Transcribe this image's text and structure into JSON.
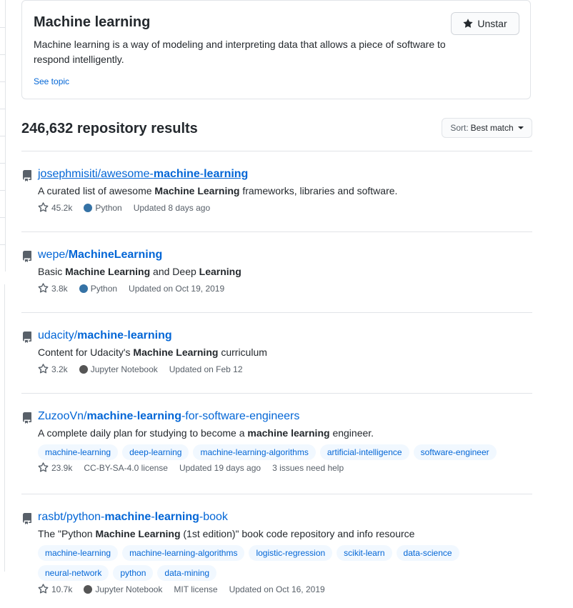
{
  "topic": {
    "title": "Machine learning",
    "description": "Machine learning is a way of modeling and interpreting data that allows a piece of software to respond intelligently.",
    "see_topic": "See topic",
    "unstar_label": "Unstar"
  },
  "results": {
    "count_label": "246,632 repository results",
    "sort_prefix": "Sort:",
    "sort_value": "Best match"
  },
  "colors": {
    "link": "#0366d6",
    "python": "#3572A5",
    "jupyter": "#555555"
  },
  "repos": [
    {
      "owner": "josephmisiti/",
      "name_parts": [
        [
          "awesome-",
          false
        ],
        [
          "machine",
          true
        ],
        [
          "-",
          false
        ],
        [
          "learning",
          true
        ]
      ],
      "visited": true,
      "description_parts": [
        [
          "A curated list of awesome ",
          false
        ],
        [
          "Machine Learning",
          true
        ],
        [
          " frameworks, libraries and software.",
          false
        ]
      ],
      "topics": [],
      "stars": "45.2k",
      "language": "Python",
      "language_color": "#3572A5",
      "license": "",
      "updated": "Updated 8 days ago",
      "issues": ""
    },
    {
      "owner": "wepe/",
      "name_parts": [
        [
          "MachineLearning",
          true
        ]
      ],
      "visited": false,
      "description_parts": [
        [
          "Basic ",
          false
        ],
        [
          "Machine Learning",
          true
        ],
        [
          " and Deep ",
          false
        ],
        [
          "Learning",
          true
        ]
      ],
      "topics": [],
      "stars": "3.8k",
      "language": "Python",
      "language_color": "#3572A5",
      "license": "",
      "updated": "Updated on Oct 19, 2019",
      "issues": ""
    },
    {
      "owner": "udacity/",
      "name_parts": [
        [
          "machine",
          true
        ],
        [
          "-",
          false
        ],
        [
          "learning",
          true
        ]
      ],
      "visited": false,
      "description_parts": [
        [
          "Content for Udacity's ",
          false
        ],
        [
          "Machine Learning",
          true
        ],
        [
          " curriculum",
          false
        ]
      ],
      "topics": [],
      "stars": "3.2k",
      "language": "Jupyter Notebook",
      "language_color": "#555555",
      "license": "",
      "updated": "Updated on Feb 12",
      "issues": ""
    },
    {
      "owner": "ZuzooVn/",
      "name_parts": [
        [
          "machine",
          true
        ],
        [
          "-",
          false
        ],
        [
          "learning",
          true
        ],
        [
          "-for-software-engineers",
          false
        ]
      ],
      "visited": false,
      "description_parts": [
        [
          "A complete daily plan for studying to become a ",
          false
        ],
        [
          "machine learning",
          true
        ],
        [
          " engineer.",
          false
        ]
      ],
      "topics": [
        "machine-learning",
        "deep-learning",
        "machine-learning-algorithms",
        "artificial-intelligence",
        "software-engineer"
      ],
      "stars": "23.9k",
      "language": "",
      "language_color": "",
      "license": "CC-BY-SA-4.0 license",
      "updated": "Updated 19 days ago",
      "issues": "3 issues need help"
    },
    {
      "owner": "rasbt/",
      "name_parts": [
        [
          "python-",
          false
        ],
        [
          "machine",
          true
        ],
        [
          "-",
          false
        ],
        [
          "learning",
          true
        ],
        [
          "-book",
          false
        ]
      ],
      "visited": false,
      "description_parts": [
        [
          "The \"Python ",
          false
        ],
        [
          "Machine Learning",
          true
        ],
        [
          " (1st edition)\" book code repository and info resource",
          false
        ]
      ],
      "topics": [
        "machine-learning",
        "machine-learning-algorithms",
        "logistic-regression",
        "scikit-learn",
        "data-science",
        "neural-network",
        "python",
        "data-mining"
      ],
      "stars": "10.7k",
      "language": "Jupyter Notebook",
      "language_color": "#555555",
      "license": "MIT license",
      "updated": "Updated on Oct 16, 2019",
      "issues": ""
    }
  ]
}
